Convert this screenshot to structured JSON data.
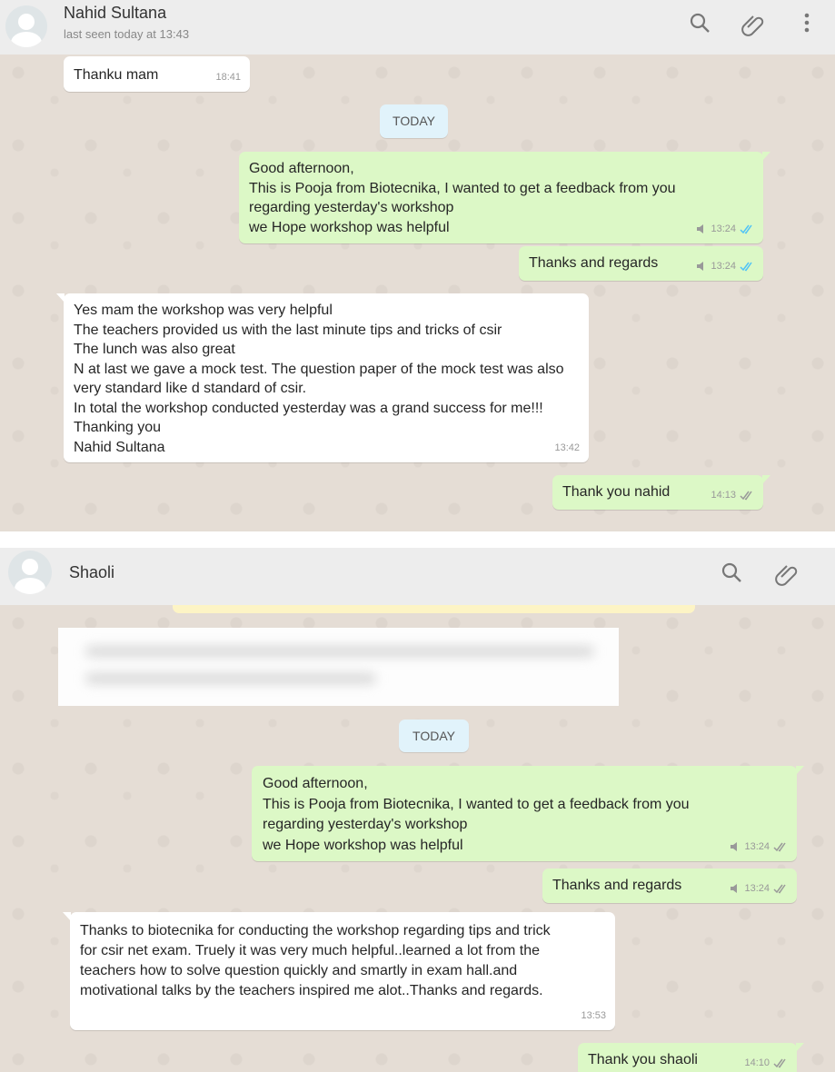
{
  "chat1": {
    "contact_name": "Nahid Sultana",
    "status": "last seen today at 13:43",
    "icons": [
      "search-icon",
      "attach-icon",
      "menu-icon"
    ],
    "date_chip": "TODAY",
    "messages": [
      {
        "direction": "in",
        "text": "Thanku mam",
        "time": "18:41"
      },
      {
        "direction": "out",
        "text": "Good afternoon,\nThis is Pooja from Biotecnika, I wanted to get a feedback from you\nregarding yesterday's workshop\nwe Hope workshop was helpful",
        "time": "13:24",
        "ticks": "read"
      },
      {
        "direction": "out",
        "text": "Thanks and regards",
        "time": "13:24",
        "ticks": "read"
      },
      {
        "direction": "in",
        "text": "Yes mam the workshop was very helpful\nThe teachers provided us with the last minute tips and tricks of csir\nThe lunch was also great\nN at last we gave a mock test. The question paper of the mock test was also\nvery standard like d standard of csir.\nIn total the workshop conducted yesterday was a grand success for me!!!\nThanking you\nNahid Sultana",
        "time": "13:42"
      },
      {
        "direction": "out",
        "text": "Thank you nahid",
        "time": "14:13",
        "ticks": "delivered"
      }
    ]
  },
  "chat2": {
    "contact_name": "Shaoli",
    "icons": [
      "search-icon",
      "attach-icon"
    ],
    "date_chip": "TODAY",
    "messages": [
      {
        "direction": "out",
        "text": "Good afternoon,\nThis is Pooja from Biotecnika, I wanted to get a feedback from you\nregarding yesterday's workshop\nwe Hope workshop was helpful",
        "time": "13:24",
        "ticks": "delivered"
      },
      {
        "direction": "out",
        "text": "Thanks and regards",
        "time": "13:24",
        "ticks": "delivered"
      },
      {
        "direction": "in",
        "text": "Thanks to biotecnika for conducting the workshop regarding tips and trick\nfor csir net exam. Truely it was very much helpful..learned a lot from the\nteachers how to solve question quickly and smartly in exam hall.and\nmotivational talks by the teachers inspired me alot..Thanks and regards.",
        "time": "13:53"
      },
      {
        "direction": "out",
        "text": "Thank you shaoli",
        "time": "14:10",
        "ticks": "delivered"
      }
    ]
  },
  "colors": {
    "read_tick": "#4fc3f7",
    "delivered_tick": "#999999",
    "outgoing_bubble": "#dcf8c6",
    "incoming_bubble": "#ffffff",
    "chat_bg": "#e5ddd5",
    "header_bg": "#ededed"
  }
}
